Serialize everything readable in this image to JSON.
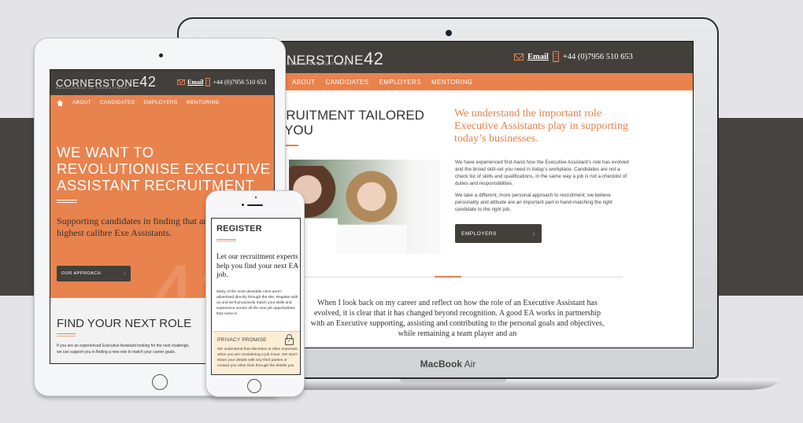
{
  "brand": {
    "logo_word": "CORNERSTONE",
    "logo_number": "42",
    "tagline": "EXCELLENCE IN RECRUITMENT",
    "accent_color": "#e8834e",
    "dark_color": "#43403c"
  },
  "contact": {
    "email_label": "Email",
    "phone": "+44 (0)7956 510 653"
  },
  "nav": {
    "items": [
      "ABOUT",
      "CANDIDATES",
      "EMPLOYERS",
      "MENTORING"
    ]
  },
  "laptop": {
    "device_label_bold": "MacBook",
    "device_label_light": "Air",
    "visible_logo_word": "RNERSTONE",
    "visible_tagline": "LLENCE IN RECRUITMENT",
    "heading": "CRUITMENT TAILORED\n) YOU",
    "subheading": "We understand the important role Executive Assistants play in supporting today’s businesses.",
    "paragraph1": "We have experienced first-hand how the Executive Assistant’s role has evolved and the broad skill-set you need in today’s workplace. Candidates are not a check list of skills and qualifications, in the same way a job is not a checklist of duties and responsibilities.",
    "paragraph2": "We take a different, more personal approach to recruitment; we believe personality and attitude are an important part in hand-matching the right candidate to the right job.",
    "button_label": "EMPLOYERS",
    "quote": "When I look back on my career and reflect on how the role of an Executive Assistant has evolved, it is clear that it has changed beyond recognition. A good EA works in partnership with an Executive supporting, assisting and contributing to the personal goals and objectives, while remaining a team player and an"
  },
  "tablet": {
    "hero_heading": "WE WANT TO\nREVOLUTIONISE EXECUTIVE\nASSISTANT RECRUITMENT",
    "hero_sub": "Supporting candidates in finding that and employers the highest calibre Exe Assistants.",
    "button_label": "OUR APPROACH",
    "role_heading": "FIND YOUR NEXT ROLE",
    "role_text": "If you are an experienced Executive Assistant looking for the next challenge, we can support you in finding a new role to match your career goals."
  },
  "phone": {
    "heading": "REGISTER",
    "lead": "Let our recruitment experts help you find your next EA job.",
    "paragraph": "Many of the most desirable roles aren’t advertised directly through the site. Register with us and we’ll proactively match your skills and experience across all the new job opportunities that come in.",
    "privacy_heading": "PRIVACY PROMISE",
    "privacy_text": "We understand that discretion is often important when you are considering a job move. We won’t share your details with any third parties or contact you other than through the details you"
  }
}
